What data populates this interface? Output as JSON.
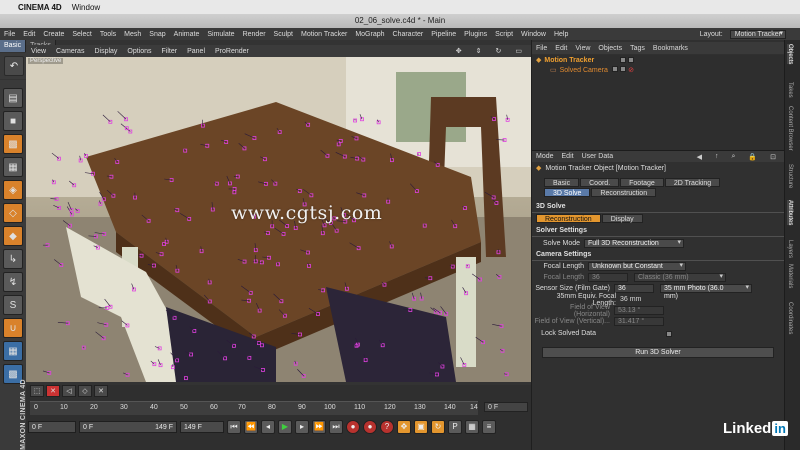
{
  "mac_menu": {
    "app_name": "CINEMA 4D",
    "window": "Window"
  },
  "window_title": "02_06_solve.c4d * - Main",
  "main_menu": [
    "File",
    "Edit",
    "Create",
    "Select",
    "Tools",
    "Mesh",
    "Snap",
    "Animate",
    "Simulate",
    "Render",
    "Sculpt",
    "Motion Tracker",
    "MoGraph",
    "Character",
    "Pipeline",
    "Plugins",
    "Script",
    "Window",
    "Help"
  ],
  "layout": {
    "label": "Layout:",
    "value": "Motion Tracker"
  },
  "mode_tabs": [
    "Basic",
    "Tracks"
  ],
  "axis_buttons": [
    "X",
    "Y",
    "Z"
  ],
  "viewport": {
    "menu": [
      "View",
      "Cameras",
      "Display",
      "Options",
      "Filter",
      "Panel",
      "ProRender"
    ],
    "camera_label": "Perspective",
    "watermark": "www.cgtsj.com"
  },
  "timeline": {
    "ticks": [
      "0",
      "10",
      "20",
      "30",
      "40",
      "50",
      "60",
      "70",
      "80",
      "90",
      "100",
      "110",
      "120",
      "130",
      "140",
      "14"
    ],
    "current_frame_field": "0 F",
    "start_field": "0 F",
    "min_field": "0 F",
    "max_field": "149 F",
    "end_field": "149 F"
  },
  "maxon_logo": "MAXON CINEMA 4D",
  "objects_panel": {
    "menu": [
      "File",
      "Edit",
      "View",
      "Objects",
      "Tags",
      "Bookmarks"
    ],
    "items": [
      {
        "name": "Motion Tracker",
        "level": 0
      },
      {
        "name": "Solved Camera",
        "level": 1
      }
    ]
  },
  "right_tabs": [
    "Objects",
    "Takes",
    "Content Browser",
    "Structure",
    "Attributes",
    "Layers",
    "Materials",
    "Coordinates"
  ],
  "attributes": {
    "menu": [
      "Mode",
      "Edit",
      "User Data"
    ],
    "title": "Motion Tracker Object [Motion Tracker]",
    "tabs": [
      "Basic",
      "Coord.",
      "Footage",
      "2D Tracking",
      "3D Solve",
      "Reconstruction"
    ],
    "active_tab": "3D Solve",
    "section_title": "3D Solve",
    "subtabs": [
      "Reconstruction",
      "Display"
    ],
    "solver_settings_title": "Solver Settings",
    "solve_mode_label": "Solve Mode",
    "solve_mode_value": "Full 3D Reconstruction",
    "camera_settings_title": "Camera Settings",
    "focal_length_label": "Focal Length",
    "focal_length_value": "Unknown but Constant",
    "focal_length_sub_label": "Focal Length",
    "focal_length_sub_value": "36",
    "focal_length_preset": "Classic (36 mm)",
    "sensor_size_label": "Sensor Size (Film Gate)",
    "sensor_size_value": "36",
    "sensor_size_preset": "35 mm Photo (36.0 mm)",
    "equiv_focal_label": "35mm Equiv. Focal Length:",
    "equiv_focal_value": "36 mm",
    "fov_h_label": "Field of View (Horizontal)",
    "fov_h_value": "53.13 °",
    "fov_v_label": "Field of View (Vertical)...",
    "fov_v_value": "31.417 °",
    "lock_label": "Lock Solved Data",
    "run_button": "Run 3D Solver"
  },
  "branding": {
    "linkedin": "Linked",
    "in": "in"
  },
  "colors": {
    "accent_blue": "#5a7aa8",
    "track_magenta": "#e040e0",
    "object_orange": "#f0a030"
  }
}
